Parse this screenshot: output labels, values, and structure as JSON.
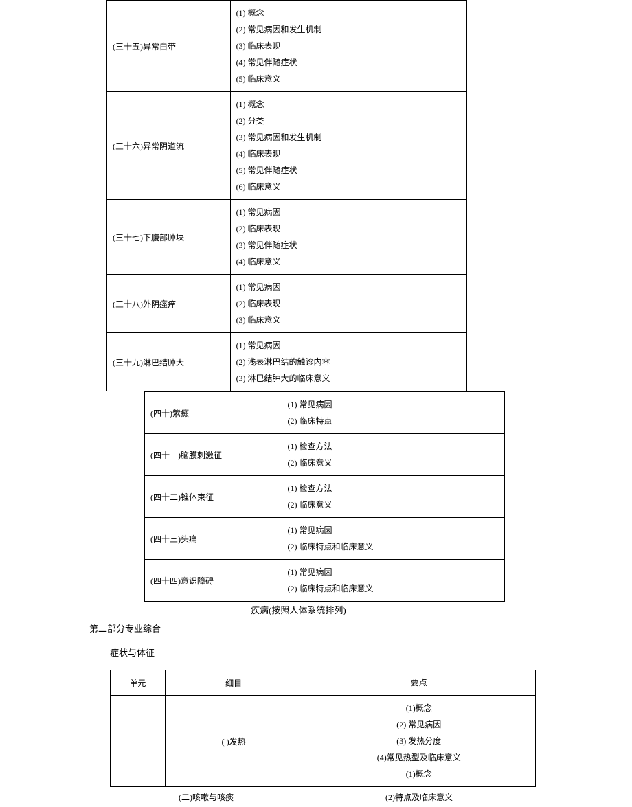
{
  "table1": {
    "rows": [
      {
        "topic": "(三十五)异常白带",
        "items": [
          "(1) 概念",
          "(2) 常见病因和发生机制",
          "(3) 临床表现",
          "(4) 常见伴随症状",
          "(5) 临床意义"
        ]
      },
      {
        "topic": "(三十六)异常阴道流",
        "items": [
          "(1) 概念",
          "(2) 分类",
          "(3) 常见病因和发生机制",
          "(4) 临床表现",
          "(5) 常见伴随症状",
          "(6) 临床意义"
        ]
      },
      {
        "topic": "(三十七)下腹部肿块",
        "items": [
          "(1) 常见病因",
          "(2) 临床表现",
          "(3) 常见伴随症状",
          "(4) 临床意义"
        ]
      },
      {
        "topic": "(三十八)外阴瘙痒",
        "items": [
          "(1) 常见病因",
          "(2) 临床表现",
          "(3) 临床意义"
        ]
      },
      {
        "topic": "(三十九)淋巴结肿大",
        "items": [
          "(1) 常见病因",
          "(2) 浅表淋巴结的触诊内容",
          "(3) 淋巴结肿大的临床意义"
        ]
      }
    ]
  },
  "table2": {
    "rows": [
      {
        "topic": "(四十)紫癜",
        "items": [
          "(1) 常见病因",
          "(2) 临床特点"
        ]
      },
      {
        "topic": "(四十一)脑膜刺激征",
        "items": [
          "(1) 检查方法",
          "(2) 临床意义"
        ]
      },
      {
        "topic": "(四十二)锥体束征",
        "items": [
          "(1) 检查方法",
          "(2) 临床意义"
        ]
      },
      {
        "topic": "(四十三)头痛",
        "items": [
          "(1) 常见病因",
          "(2) 临床特点和临床意义"
        ]
      },
      {
        "topic": "(四十四)意识障碍",
        "items": [
          "(1) 常见病因",
          "(2) 临床特点和临床意义"
        ]
      }
    ]
  },
  "headings": {
    "disease": "疾病(按照人体系统排列)",
    "part2": "第二部分专业综合",
    "symptoms": "症状与体征"
  },
  "table3": {
    "header": {
      "unit": "单元",
      "detail": "细目",
      "points": "要点"
    },
    "row1": {
      "unit": "",
      "detail": "( )发热",
      "points": [
        "(1)概念",
        "(2) 常见病因",
        "(3) 发热分度",
        "(4)常见热型及临床意义",
        "(1)概念"
      ]
    }
  },
  "bottom": {
    "left": "(二)咳嗽与咳痰",
    "right": "(2)特点及临床意义"
  }
}
